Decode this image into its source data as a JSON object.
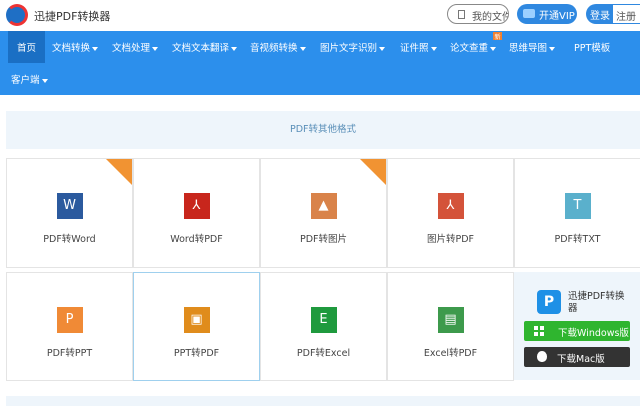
{
  "header": {
    "logo_text": "迅捷PDF转换器",
    "my_docs": "我的文件",
    "vip": "开通VIP",
    "login": "登录",
    "register": "注册"
  },
  "nav": {
    "items": [
      {
        "label": "首页",
        "dropdown": false,
        "active": true
      },
      {
        "label": "文档转换",
        "dropdown": true
      },
      {
        "label": "文档处理",
        "dropdown": true
      },
      {
        "label": "文档文本翻译",
        "dropdown": true
      },
      {
        "label": "音视频转换",
        "dropdown": true
      },
      {
        "label": "图片文字识别",
        "dropdown": true
      },
      {
        "label": "证件照",
        "dropdown": true
      },
      {
        "label": "论文查重",
        "dropdown": true,
        "badge": "新"
      },
      {
        "label": "思维导图",
        "dropdown": true
      },
      {
        "label": "PPT模板",
        "dropdown": false
      },
      {
        "label": "客户端",
        "dropdown": true
      }
    ]
  },
  "section_title": "PDF转其他格式",
  "tools": [
    {
      "label": "PDF转Word",
      "glyph": "W",
      "color": "#2b5a9e",
      "hot": true
    },
    {
      "label": "Word转PDF",
      "glyph": "⅄",
      "color": "#c8261c",
      "hot": false
    },
    {
      "label": "PDF转图片",
      "glyph": "▲",
      "color": "#d9834a",
      "hot": true
    },
    {
      "label": "图片转PDF",
      "glyph": "⅄",
      "color": "#d4533a",
      "hot": false
    },
    {
      "label": "PDF转TXT",
      "glyph": "T",
      "color": "#5ab0cc",
      "hot": false
    },
    {
      "label": "PDF转PPT",
      "glyph": "P",
      "color": "#f08a36",
      "hot": false
    },
    {
      "label": "PPT转PDF",
      "glyph": "▣",
      "color": "#e08c1c",
      "hot": false,
      "selected": true
    },
    {
      "label": "PDF转Excel",
      "glyph": "E",
      "color": "#1f9a3e",
      "hot": false
    },
    {
      "label": "Excel转PDF",
      "glyph": "▤",
      "color": "#3d9a4c",
      "hot": false
    }
  ],
  "promo": {
    "app_name": "迅捷PDF转换器",
    "windows": "下载Windows版",
    "mac": "下载Mac版"
  }
}
